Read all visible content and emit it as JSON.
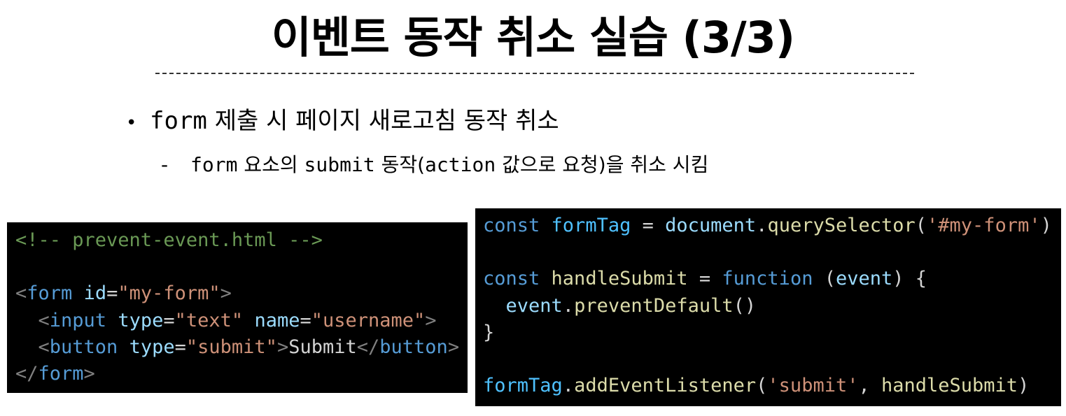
{
  "slide": {
    "title": "이벤트 동작 취소 실습 (3/3)",
    "bullet": {
      "code": "form",
      "text": " 제출 시 페이지 새로고침 동작 취소"
    },
    "sub_bullet": {
      "dash": "-",
      "code1": "form",
      "text1": " 요소의 ",
      "code2": "submit",
      "text2": " 동작(",
      "code3": "action",
      "text3": " 값으로 요청)을 취소 시킴"
    }
  },
  "html_code": {
    "comment": "<!-- prevent-event.html -->",
    "form_open": {
      "lt": "<",
      "tag": "form",
      "attr": "id",
      "eq": "=",
      "val": "\"my-form\"",
      "gt": ">"
    },
    "input_line": {
      "indent": "  ",
      "lt": "<",
      "tag": "input",
      "attr1": "type",
      "eq1": "=",
      "val1": "\"text\"",
      "attr2": "name",
      "eq2": "=",
      "val2": "\"username\"",
      "gt": ">"
    },
    "button_line": {
      "indent": "  ",
      "lt": "<",
      "tag": "button",
      "attr": "type",
      "eq": "=",
      "val": "\"submit\"",
      "gt": ">",
      "text": "Submit",
      "close_lt": "</",
      "close_tag": "button",
      "close_gt": ">"
    },
    "form_close": {
      "lt": "</",
      "tag": "form",
      "gt": ">"
    }
  },
  "js_code": {
    "line1": {
      "kw": "const",
      "name": "formTag",
      "op": " = ",
      "obj": "document",
      "dot": ".",
      "fn": "querySelector",
      "open": "(",
      "str": "'#my-form'",
      "close": ")"
    },
    "line2": {
      "kw": "const",
      "name": "handleSubmit",
      "op": " = ",
      "fnkw": "function",
      "open": " (",
      "param": "event",
      "close": ") {"
    },
    "line3": {
      "indent": "  ",
      "obj": "event",
      "dot": ".",
      "fn": "preventDefault",
      "call": "()"
    },
    "line4": {
      "brace": "}"
    },
    "line5": {
      "obj": "formTag",
      "dot": ".",
      "fn": "addEventListener",
      "open": "(",
      "str": "'submit'",
      "sep": ", ",
      "arg": "handleSubmit",
      "close": ")"
    }
  }
}
